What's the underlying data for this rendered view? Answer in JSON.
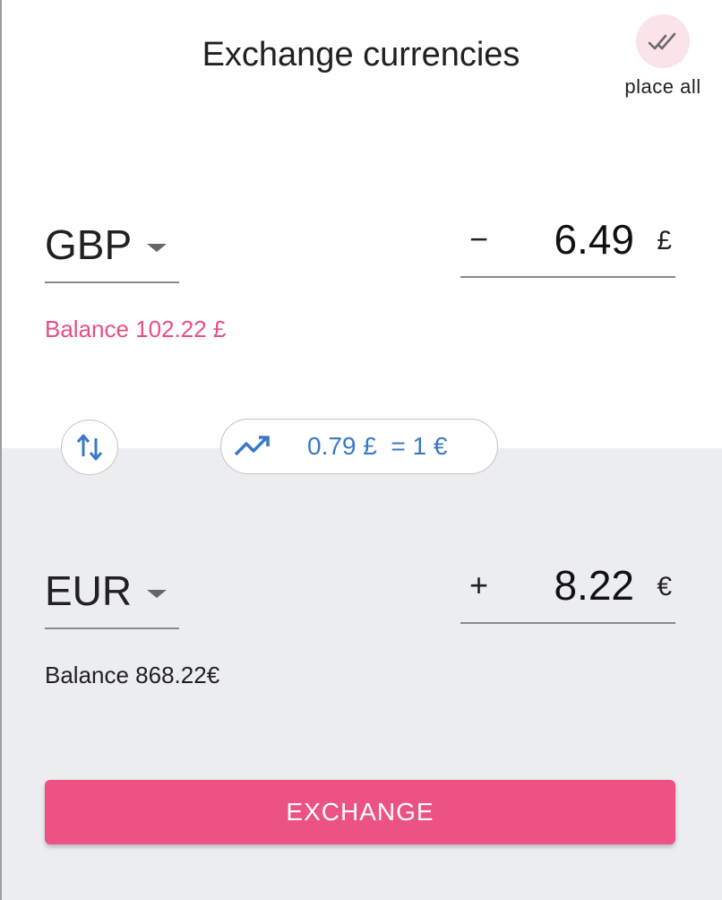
{
  "header": {
    "title": "Exchange currencies",
    "place_all_label": "place all",
    "place_all_icon": "double-check-icon"
  },
  "from": {
    "currency": "GBP",
    "sign": "−",
    "amount": "6.49",
    "symbol": "£",
    "balance": "Balance 102.22 £",
    "balance_color": "#e8507f"
  },
  "to": {
    "currency": "EUR",
    "sign": "+",
    "amount": "8.22",
    "symbol": "€",
    "balance": "Balance 868.22€"
  },
  "rate": {
    "text": "0.79 £  = 1 €",
    "icon": "trending-up-icon",
    "color": "#3b78c5"
  },
  "swap": {
    "icon": "swap-vertical-icon"
  },
  "actions": {
    "exchange_label": "EXCHANGE",
    "accent": "#ec5282"
  }
}
